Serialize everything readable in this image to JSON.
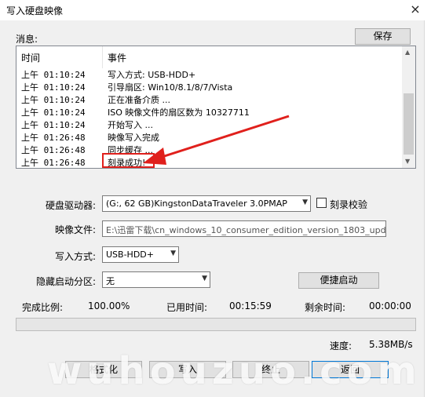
{
  "window": {
    "title": "写入硬盘映像",
    "close": "×"
  },
  "messages": {
    "label": "消息:",
    "save_button": "保存"
  },
  "log": {
    "columns": [
      "时间",
      "事件"
    ],
    "rows": [
      {
        "time": "上午 01:10:24",
        "event": "写入方式: USB-HDD+"
      },
      {
        "time": "上午 01:10:24",
        "event": "引导扇区: Win10/8.1/8/7/Vista"
      },
      {
        "time": "上午 01:10:24",
        "event": "正在准备介质 ..."
      },
      {
        "time": "上午 01:10:24",
        "event": "ISO 映像文件的扇区数为 10327711"
      },
      {
        "time": "上午 01:10:24",
        "event": "开始写入 ..."
      },
      {
        "time": "上午 01:26:48",
        "event": "映像写入完成"
      },
      {
        "time": "上午 01:26:48",
        "event": "同步缓存 ..."
      },
      {
        "time": "上午 01:26:48",
        "event": "刻录成功!"
      }
    ],
    "highlight_color": "#e0201c"
  },
  "drive": {
    "label": "硬盘驱动器:",
    "value": "(G:, 62 GB)KingstonDataTraveler 3.0PMAP",
    "verify_label": "刻录校验",
    "verify_checked": false
  },
  "image_file": {
    "label": "映像文件:",
    "value": "E:\\迅雷下载\\cn_windows_10_consumer_edition_version_1803_upd"
  },
  "write_mode": {
    "label": "写入方式:",
    "value": "USB-HDD+"
  },
  "hidden_partition": {
    "label": "隐藏启动分区:",
    "value": "无"
  },
  "quick_boot_button": "便捷启动",
  "status": {
    "done_label": "完成比例:",
    "done_value": "100.00%",
    "elapsed_label": "已用时间:",
    "elapsed_value": "00:15:59",
    "remaining_label": "剩余时间:",
    "remaining_value": "00:00:00",
    "speed_label": "速度:",
    "speed_value": "5.38MB/s",
    "progress": 0
  },
  "buttons": {
    "format": "格式化",
    "write": "写入",
    "terminate": "终止",
    "back": "返回"
  },
  "watermark": "wuhouzuo.com"
}
